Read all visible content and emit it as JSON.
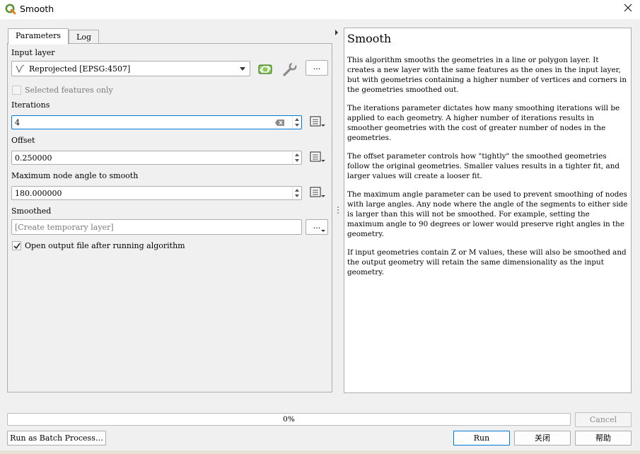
{
  "window": {
    "title": "Smooth",
    "app_icon": "qgis-icon"
  },
  "tabs": [
    {
      "label": "Parameters"
    },
    {
      "label": "Log"
    }
  ],
  "params": {
    "input_layer": {
      "label": "Input layer",
      "value": "Reprojected [EPSG:4507]",
      "more_label": "..."
    },
    "selected_only": {
      "label": "Selected features only",
      "checked": false
    },
    "iterations": {
      "label": "Iterations",
      "value": "4"
    },
    "offset": {
      "label": "Offset",
      "value": "0.250000"
    },
    "max_angle": {
      "label": "Maximum node angle to smooth",
      "value": "180.000000"
    },
    "smoothed": {
      "label": "Smoothed",
      "placeholder": "[Create temporary layer]",
      "more_label": "..."
    },
    "open_output": {
      "label": "Open output file after running algorithm",
      "checked": true
    }
  },
  "help": {
    "title": "Smooth",
    "paragraphs": [
      "This algorithm smooths the geometries in a line or polygon layer. It creates a new layer with the same features as the ones in the input layer, but with geometries containing a higher number of vertices and corners in the geometries smoothed out.",
      "The iterations parameter dictates how many smoothing iterations will be applied to each geometry. A higher number of iterations results in smoother geometries with the cost of greater number of nodes in the geometries.",
      "The offset parameter controls how \"tightly\" the smoothed geometries follow the original geometries. Smaller values results in a tighter fit, and larger values will create a looser fit.",
      "The maximum angle parameter can be used to prevent smoothing of nodes with large angles. Any node where the angle of the segments to either side is larger than this will not be smoothed. For example, setting the maximum angle to 90 degrees or lower would preserve right angles in the geometry.",
      "If input geometries contain Z or M values, these will also be smoothed and the output geometry will retain the same dimensionality as the input geometry."
    ]
  },
  "progress": {
    "percent_label": "0%",
    "value": 0
  },
  "buttons": {
    "cancel": "Cancel",
    "batch": "Run as Batch Process…",
    "run": "Run",
    "close": "关闭",
    "help": "帮助"
  },
  "colors": {
    "accent": "#0078d7",
    "qgis_green": "#589632"
  }
}
